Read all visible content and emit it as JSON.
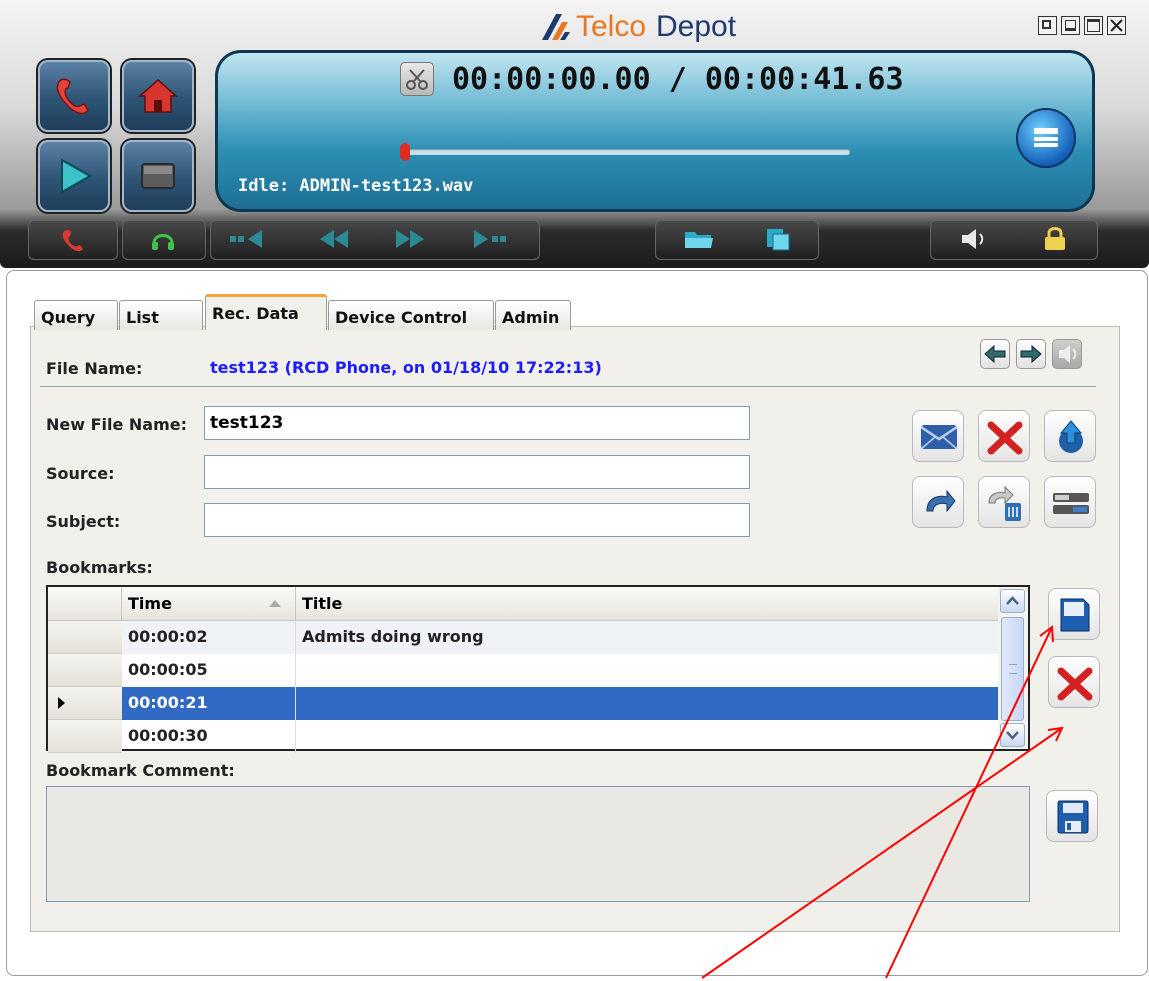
{
  "app": {
    "brand": "TelcoDepot",
    "brand_telco": "Telco",
    "brand_depot": "Depot",
    "accent": "#e87722",
    "brand_blue": "#1f3a6e"
  },
  "player": {
    "elapsed": "00:00:00.00",
    "separator": "/",
    "total": "00:00:41.63",
    "status": "Idle: ADMIN-test123.wav",
    "progress_fraction": 0.0
  },
  "tabs": [
    {
      "label": "Query"
    },
    {
      "label": "List"
    },
    {
      "label": "Rec. Data"
    },
    {
      "label": "Device Control"
    },
    {
      "label": "Admin"
    }
  ],
  "active_tab": "Rec. Data",
  "rec_data": {
    "file_name_label": "File Name:",
    "file_name_value": "test123 (RCD Phone, on 01/18/10 17:22:13)",
    "new_file_name_label": "New File Name:",
    "new_file_name_value": "test123",
    "source_label": "Source:",
    "source_value": "",
    "subject_label": "Subject:",
    "subject_value": "",
    "bookmarks_label": "Bookmarks:",
    "bookmark_comment_label": "Bookmark Comment:",
    "bookmark_comment_value": ""
  },
  "bookmarks": {
    "columns": [
      "Time",
      "Title"
    ],
    "rows": [
      {
        "time": "00:00:02",
        "title": "Admits doing wrong"
      },
      {
        "time": "00:00:05",
        "title": ""
      },
      {
        "time": "00:00:21",
        "title": ""
      },
      {
        "time": "00:00:30",
        "title": ""
      }
    ],
    "selected_index": 2,
    "sort_column": "Time",
    "sort_direction": "ascending",
    "selection_color": "#316ac5"
  },
  "icons": {
    "toolbar": [
      "phone-icon",
      "home-icon",
      "play-icon",
      "stop-icon"
    ],
    "bottom": [
      "hangup-icon",
      "headset-icon",
      "skip-start-icon",
      "rewind-icon",
      "fast-forward-icon",
      "skip-end-icon",
      "open-folder-icon",
      "copy-files-icon",
      "volume-icon",
      "lock-icon"
    ],
    "window": [
      "restore-icon",
      "minimize-icon",
      "maximize-icon",
      "close-icon"
    ],
    "actions": [
      "email-icon",
      "delete-icon",
      "upload-icon",
      "redo-icon",
      "redo-delete-icon",
      "toggle-icon",
      "bookmark-add-icon",
      "bookmark-delete-icon",
      "save-icon"
    ]
  },
  "annotation_color": "#ff0000"
}
